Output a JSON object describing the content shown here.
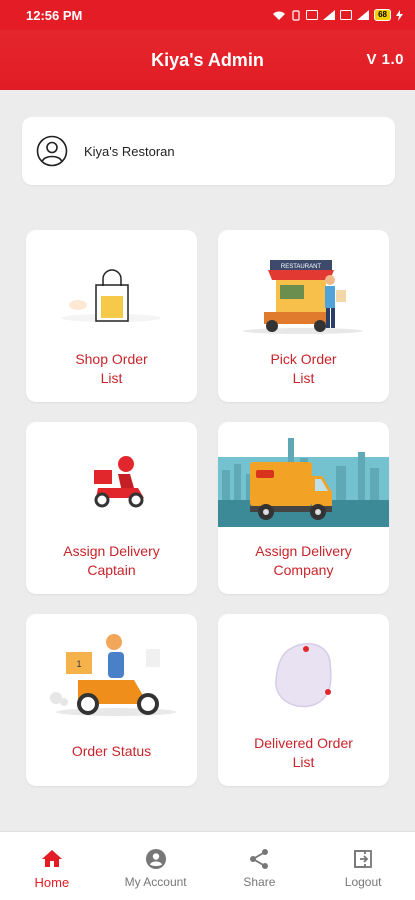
{
  "status_bar": {
    "time": "12:56 PM",
    "battery": "68"
  },
  "app_bar": {
    "title": "Kiya's Admin",
    "version": "V 1.0"
  },
  "restaurant": {
    "name": "Kiya's Restoran"
  },
  "tiles": [
    {
      "label_line1": "Shop Order",
      "label_line2": "List"
    },
    {
      "label_line1": "Pick Order",
      "label_line2": "List",
      "sign_text": "RESTAURANT"
    },
    {
      "label_line1": "Assign Delivery",
      "label_line2": "Captain"
    },
    {
      "label_line1": "Assign Delivery",
      "label_line2": "Company"
    },
    {
      "label_line1": "Order Status",
      "label_line2": ""
    },
    {
      "label_line1": "Delivered Order",
      "label_line2": "List"
    }
  ],
  "bottom_nav": [
    {
      "label": "Home",
      "icon": "home-icon",
      "active": true
    },
    {
      "label": "My Account",
      "icon": "account-icon",
      "active": false
    },
    {
      "label": "Share",
      "icon": "share-icon",
      "active": false
    },
    {
      "label": "Logout",
      "icon": "logout-icon",
      "active": false
    }
  ],
  "colors": {
    "accent": "#e31c25",
    "label": "#c8242a",
    "background": "#ececec"
  }
}
